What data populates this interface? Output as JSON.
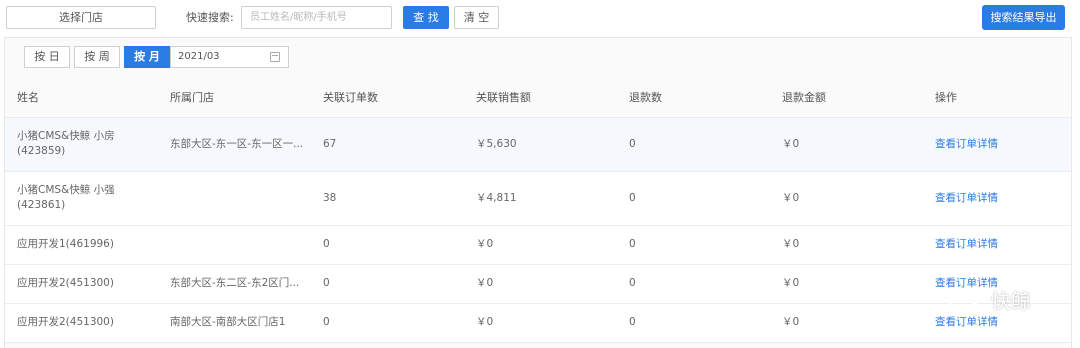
{
  "toolbar": {
    "store_select_label": "选择门店",
    "quick_search_label": "快速搜索:",
    "search_placeholder": "员工姓名/昵称/手机号",
    "find_label": "查 找",
    "clear_label": "清 空",
    "export_label": "搜索结果导出"
  },
  "period": {
    "by_day": "按 日",
    "by_week": "按 周",
    "by_month": "按 月",
    "active": "by_month",
    "date_value": "2021/03"
  },
  "table": {
    "headers": [
      "姓名",
      "所属门店",
      "关联订单数",
      "关联销售额",
      "退款数",
      "退款金额",
      "操作"
    ],
    "rows": [
      {
        "name_line1": "小猪CMS&快鲸 小房",
        "name_line2": "(423859)",
        "store": "东部大区-东一区-东一区一...",
        "orders": "67",
        "sales": "￥5,630",
        "refunds": "0",
        "refund_amount": "￥0",
        "action": "查看订单详情"
      },
      {
        "name_line1": "小猪CMS&快鲸 小强",
        "name_line2": "(423861)",
        "store": "",
        "orders": "38",
        "sales": "￥4,811",
        "refunds": "0",
        "refund_amount": "￥0",
        "action": "查看订单详情"
      },
      {
        "name_line1": "应用开发1(461996)",
        "name_line2": "",
        "store": "",
        "orders": "0",
        "sales": "￥0",
        "refunds": "0",
        "refund_amount": "￥0",
        "action": "查看订单详情"
      },
      {
        "name_line1": "应用开发2(451300)",
        "name_line2": "",
        "store": "东部大区-东二区-东2区门...",
        "orders": "0",
        "sales": "￥0",
        "refunds": "0",
        "refund_amount": "￥0",
        "action": "查看订单详情"
      },
      {
        "name_line1": "应用开发2(451300)",
        "name_line2": "",
        "store": "南部大区-南部大区门店1",
        "orders": "0",
        "sales": "￥0",
        "refunds": "0",
        "refund_amount": "￥0",
        "action": "查看订单详情"
      }
    ]
  },
  "watermark": {
    "text": "快鲸",
    "icon": "whale-logo-icon"
  },
  "colors": {
    "primary": "#2a7be4",
    "highlight_row": "#f5f9fd",
    "border": "#ececec"
  }
}
